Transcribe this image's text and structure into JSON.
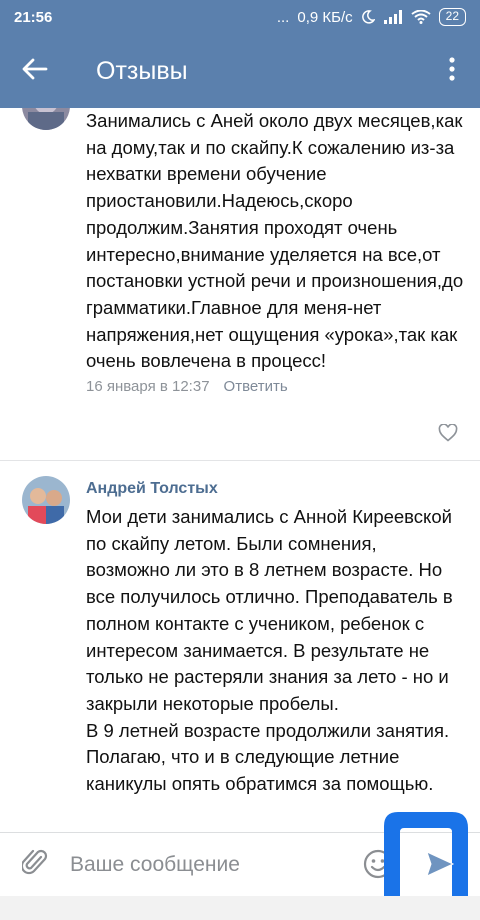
{
  "status_bar": {
    "time": "21:56",
    "dots": "...",
    "network_speed": "0,9 КБ/с",
    "battery": "22"
  },
  "app_bar": {
    "title": "Отзывы",
    "back_icon": "arrow-left-icon",
    "more_icon": "more-vertical-icon"
  },
  "comments": [
    {
      "author": "",
      "text": "Занимались с Аней около двух месяцев,как на дому,так и по скайпу.К сожалению из-за нехватки времени обучение приостановили.Надеюсь,скоро продолжим.Занятия проходят очень интересно,внимание уделяется на все,от постановки устной речи и произношения,до грамматики.Главное для меня-нет напряжения,нет ощущения «урока»,так как очень вовлечена в процесс!",
      "date": "16 января в 12:37",
      "reply_label": "Ответить"
    },
    {
      "author": "Андрей Толстых",
      "text": "Мои дети занимались с Анной Киреевской по скайпу летом. Были сомнения, возможно ли это в 8 летнем возрасте. Но все получилось отлично. Преподаватель в полном контакте с учеником, ребенок с интересом занимается. В результате не только не растеряли знания за лето - но и закрыли некоторые пробелы.\nВ 9 летней возрасте продолжили занятия. Полагаю, что и в следующие летние каникулы опять обратимся за помощью."
    }
  ],
  "input_bar": {
    "placeholder": "Ваше сообщение",
    "attach_icon": "paperclip-icon",
    "emoji_icon": "smile-icon",
    "send_icon": "send-icon"
  },
  "colors": {
    "header": "#5b80ad",
    "author": "#4d6d91",
    "meta": "#8e9399",
    "logo_blue": "#1a73e8"
  }
}
